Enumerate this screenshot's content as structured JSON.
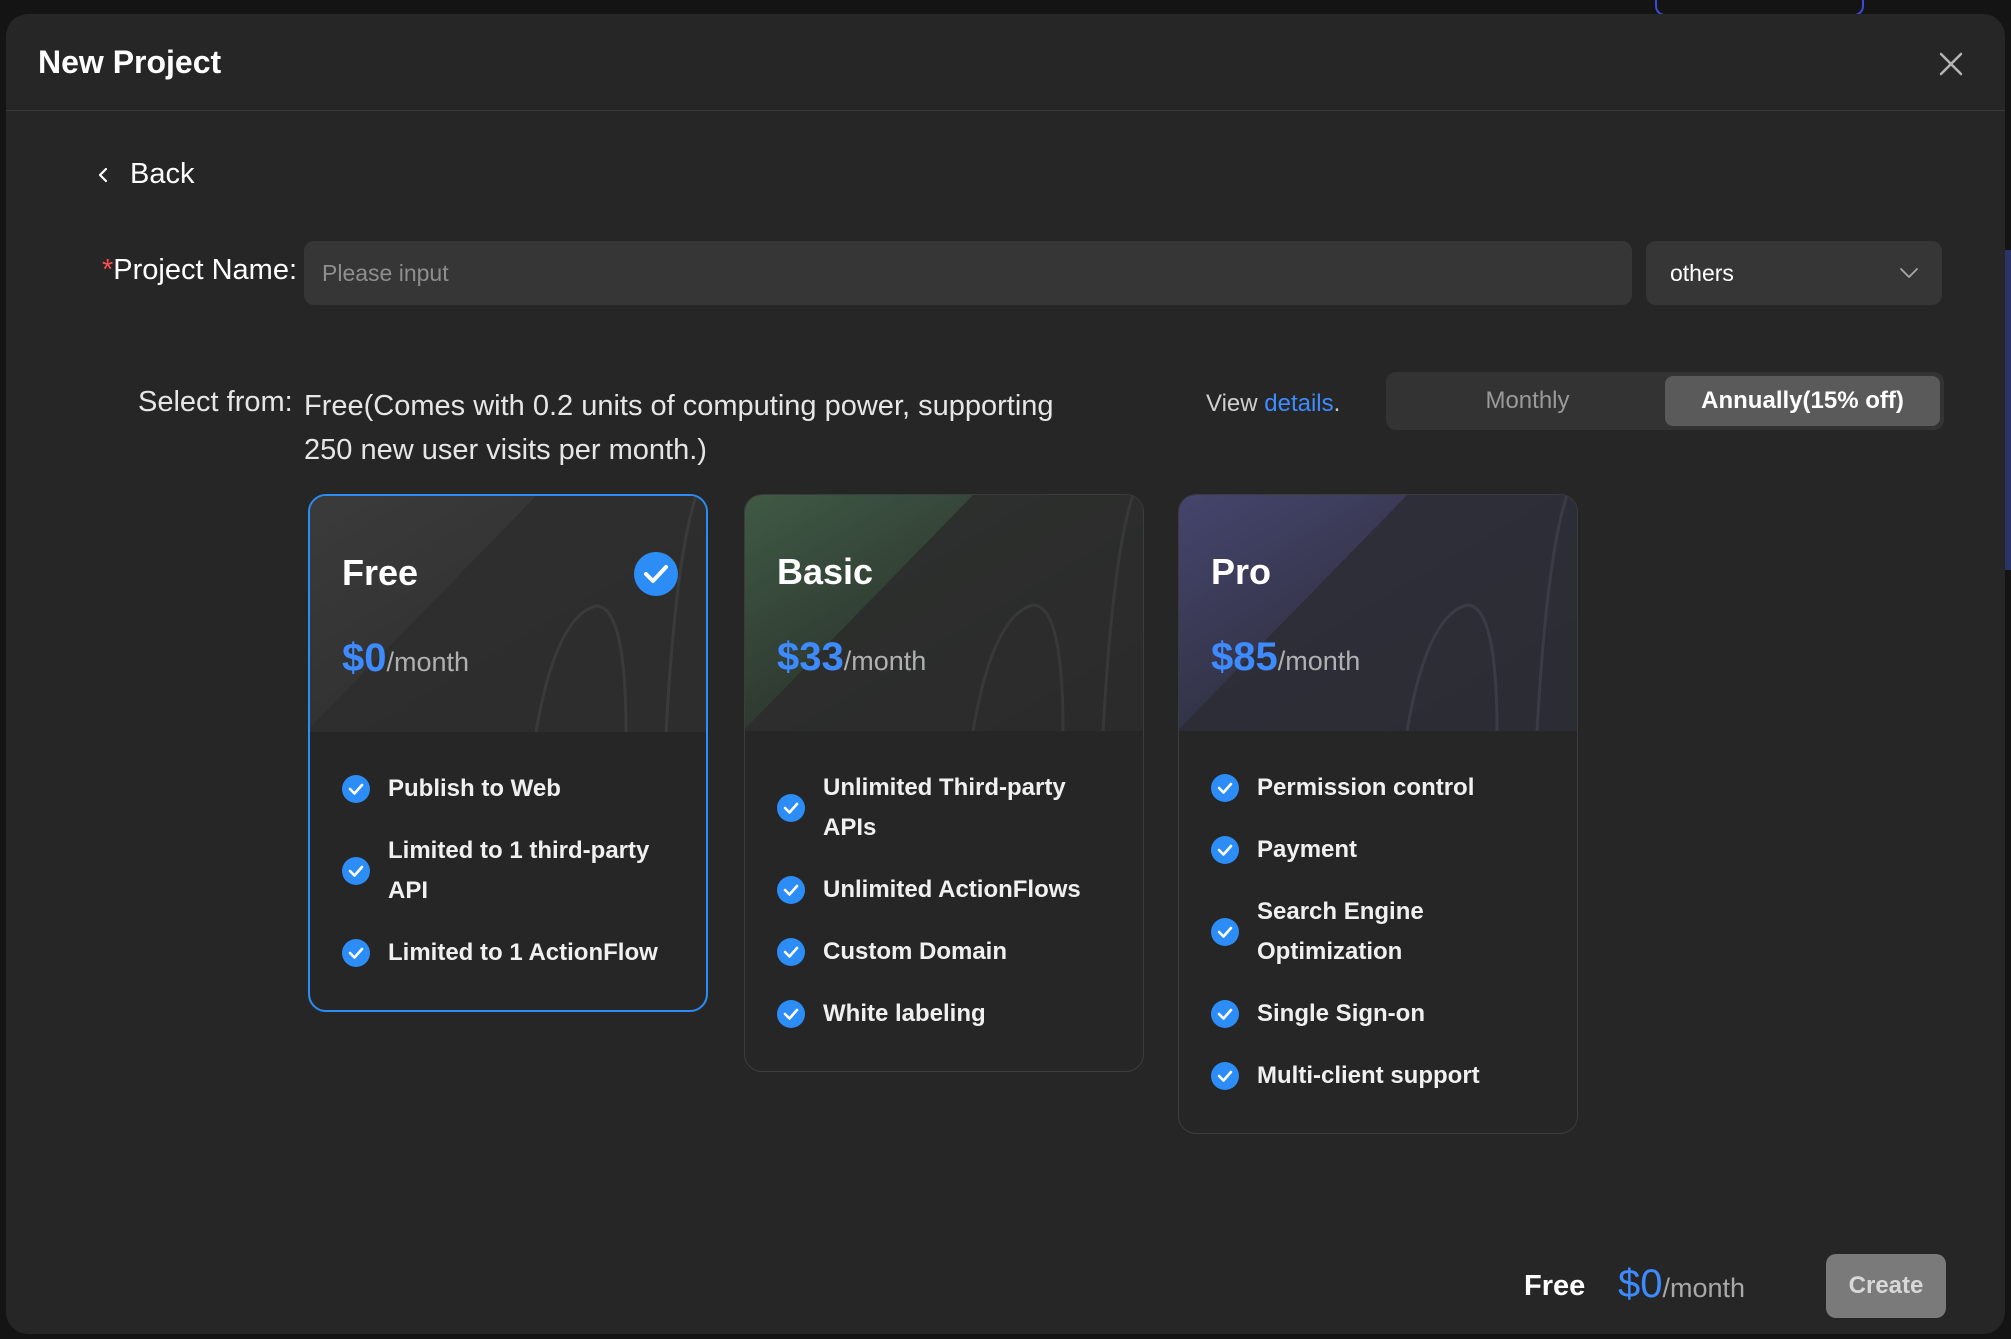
{
  "modal": {
    "title": "New Project"
  },
  "back": {
    "label": "Back"
  },
  "project_name": {
    "required_mark": "*",
    "label": "Project Name:",
    "placeholder": "Please input",
    "value": ""
  },
  "category_select": {
    "value": "others"
  },
  "plan_select": {
    "label": "Select from:",
    "description": "Free(Comes with 0.2 units of computing power, supporting 250 new user visits per month.)",
    "view_prefix": "View ",
    "details_link": "details",
    "view_suffix": "."
  },
  "billing": {
    "monthly": "Monthly",
    "annually": "Annually(15% off)",
    "selected": "Annually(15% off)"
  },
  "plans": [
    {
      "name": "Free",
      "price": "$0",
      "period": "/month",
      "selected": true,
      "accent": "#2b8df5",
      "features": [
        "Publish to Web",
        "Limited to 1 third-party API",
        "Limited to 1 ActionFlow"
      ]
    },
    {
      "name": "Basic",
      "price": "$33",
      "period": "/month",
      "selected": false,
      "accent": "#3a5a40",
      "features": [
        "Unlimited Third-party APIs",
        "Unlimited ActionFlows",
        "Custom Domain",
        "White labeling"
      ]
    },
    {
      "name": "Pro",
      "price": "$85",
      "period": "/month",
      "selected": false,
      "accent": "#3d3d66",
      "features": [
        "Permission control",
        "Payment",
        "Search Engine Optimization",
        "Single Sign-on",
        "Multi-client support"
      ]
    }
  ],
  "footer": {
    "plan": "Free",
    "price": "$0",
    "period": "/month",
    "create_label": "Create"
  },
  "colors": {
    "primary": "#3d8bff",
    "background": "#262626",
    "required": "#ff4d4f"
  }
}
